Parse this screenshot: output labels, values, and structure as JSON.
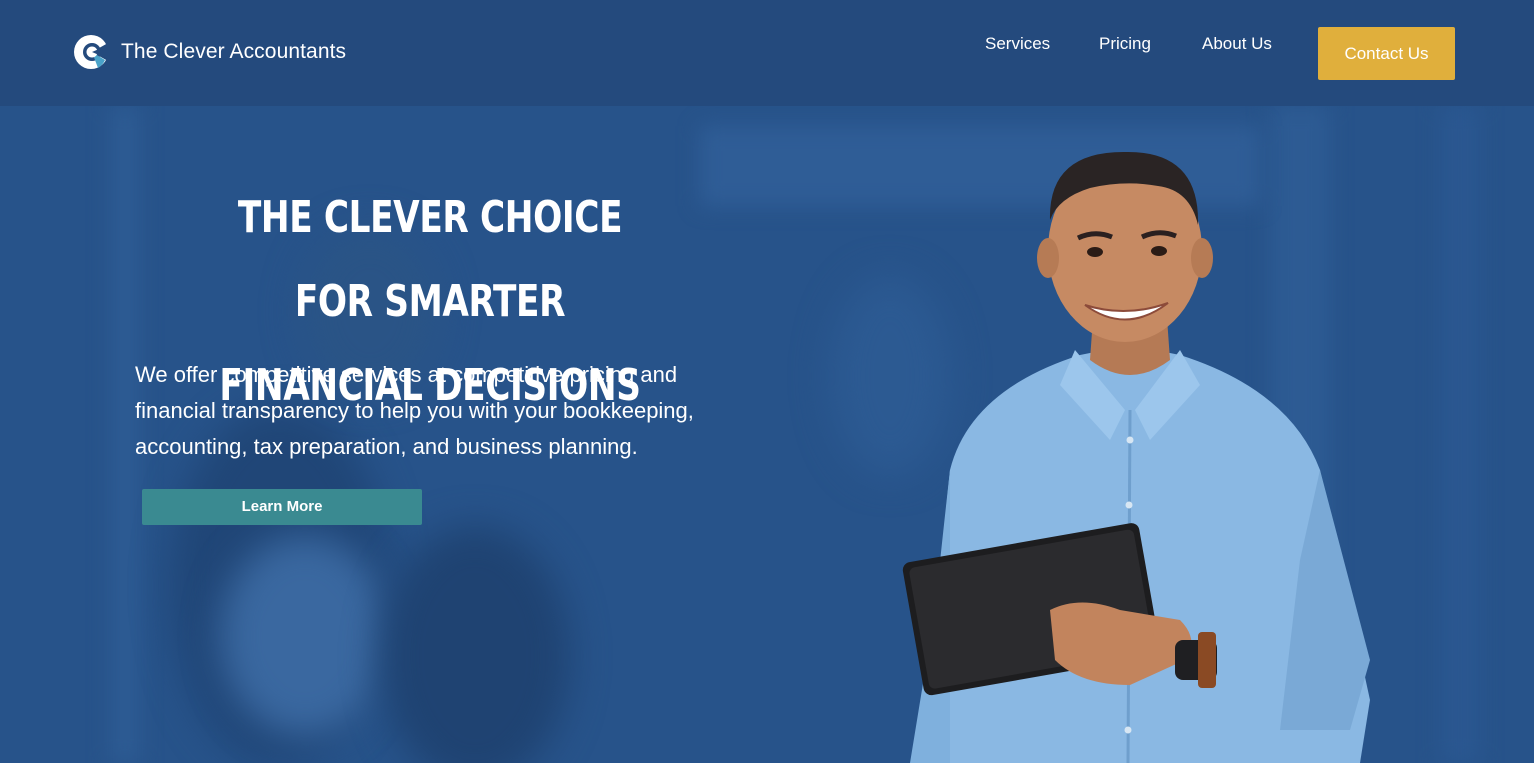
{
  "header": {
    "brand": "The Clever Accountants",
    "nav": {
      "services": "Services",
      "pricing": "Pricing",
      "about": "About Us"
    },
    "contact_label": "Contact Us"
  },
  "hero": {
    "headline_line1": "THE CLEVER CHOICE FOR SMARTER",
    "headline_line2": "FINANCIAL DECISIONS",
    "subtext_line1": "We offer competitive services at competitive pricing and",
    "subtext_line2": "financial transparency to help you with your bookkeeping,",
    "subtext_line3": "accounting, tax preparation, and business planning.",
    "cta_label": "Learn More"
  },
  "colors": {
    "header_bg": "#244a7d",
    "hero_bg": "#27538a",
    "contact_button": "#e0af3c",
    "learn_button": "#3a8a91",
    "text": "#ffffff"
  },
  "icons": {
    "logo": "clever-c-logo-icon"
  }
}
